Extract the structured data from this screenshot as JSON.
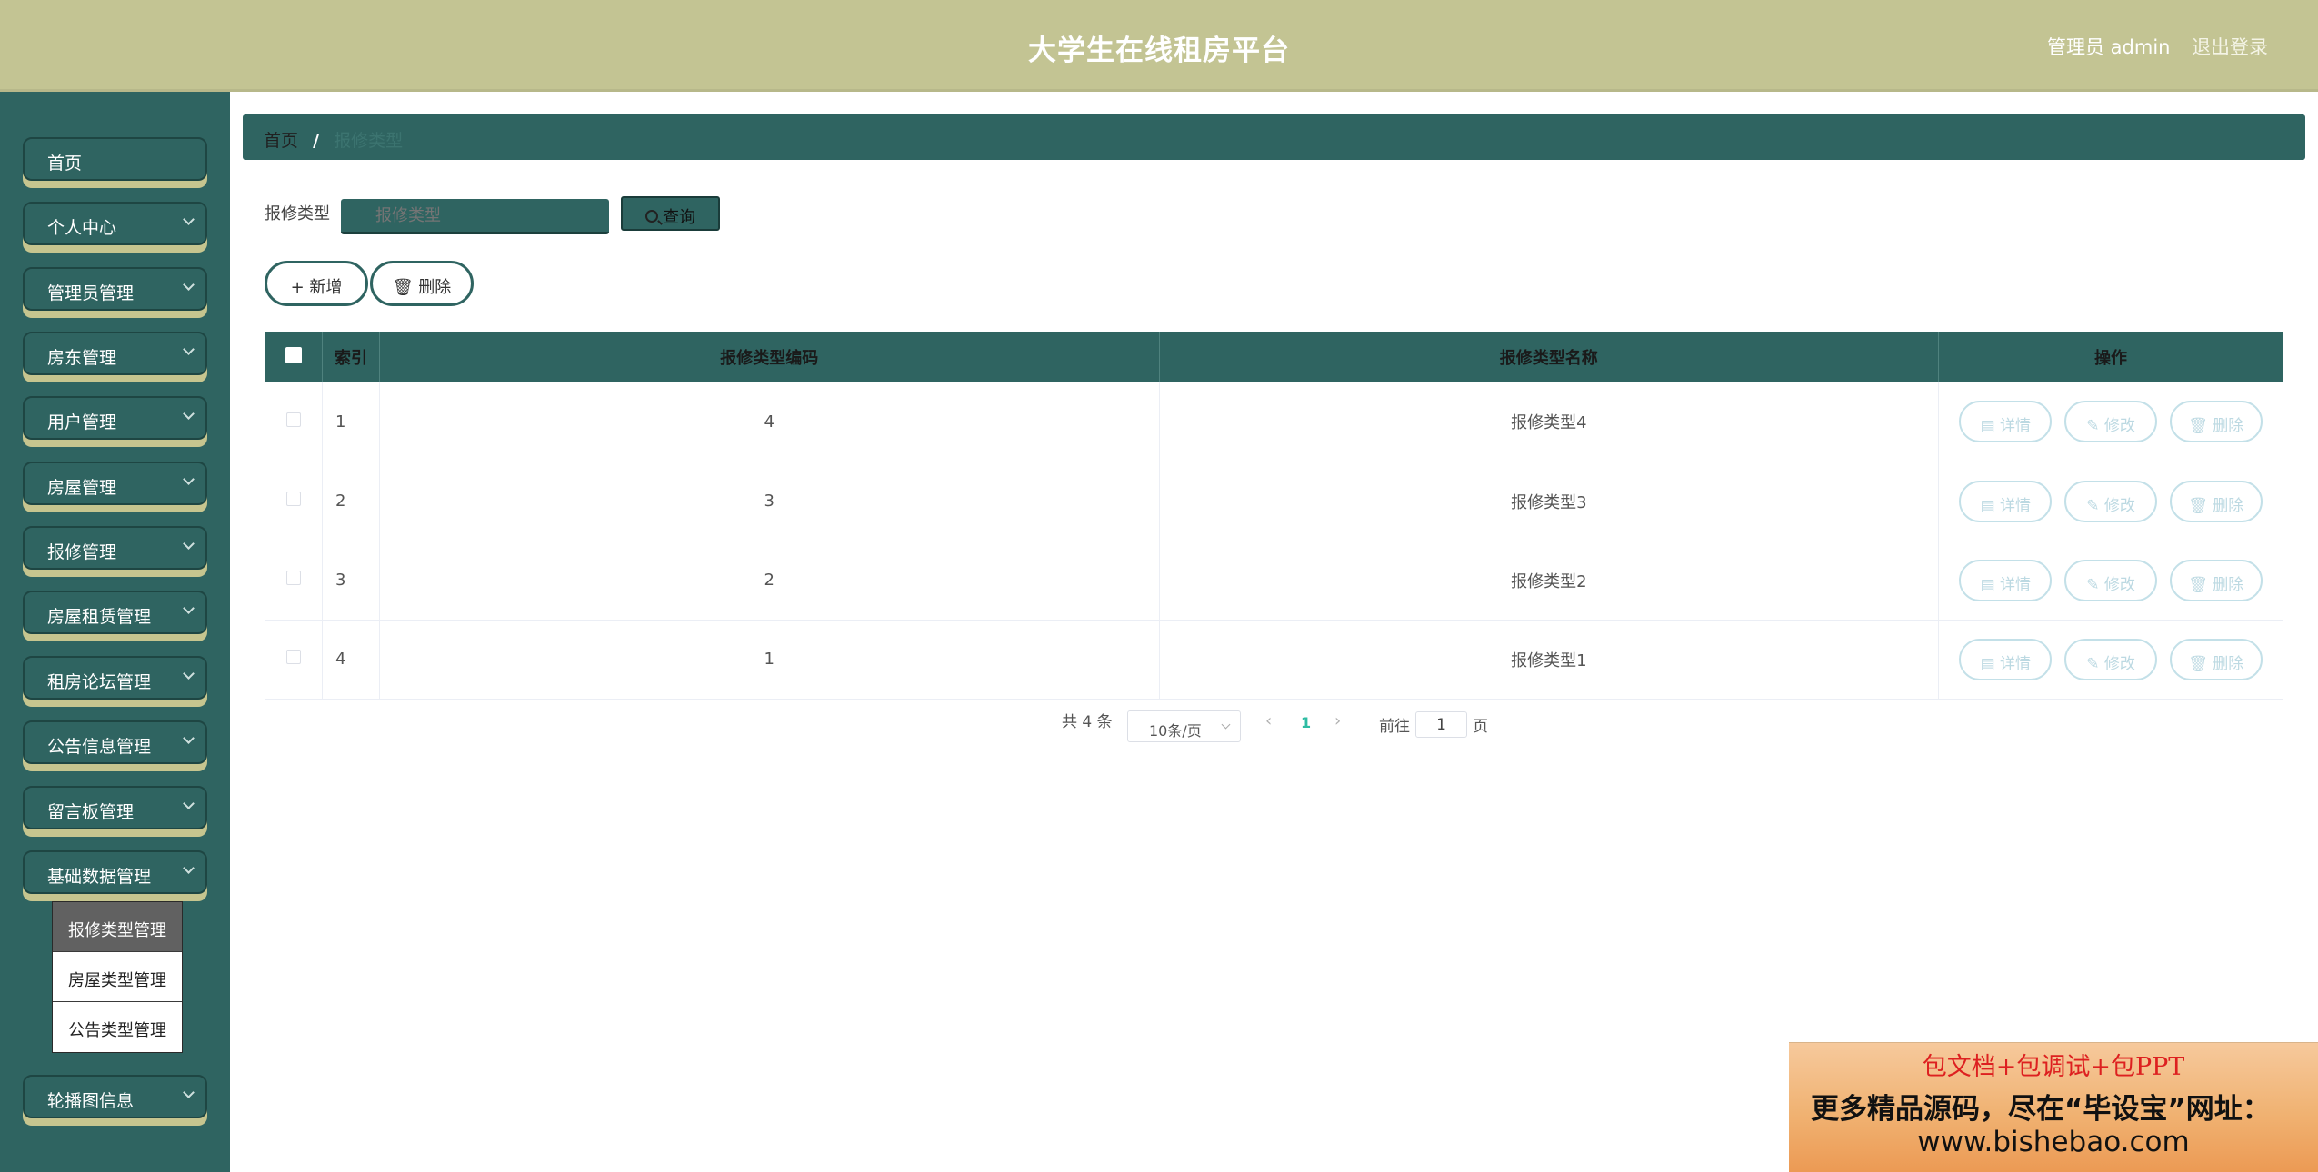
{
  "header": {
    "title": "大学生在线租房平台",
    "admin_label": "管理员 admin",
    "logout_label": "退出登录"
  },
  "sidebar": {
    "items": [
      {
        "label": "首页",
        "has_arrow": false
      },
      {
        "label": "个人中心",
        "has_arrow": true
      },
      {
        "label": "管理员管理",
        "has_arrow": true
      },
      {
        "label": "房东管理",
        "has_arrow": true
      },
      {
        "label": "用户管理",
        "has_arrow": true
      },
      {
        "label": "房屋管理",
        "has_arrow": true
      },
      {
        "label": "报修管理",
        "has_arrow": true
      },
      {
        "label": "房屋租赁管理",
        "has_arrow": true
      },
      {
        "label": "租房论坛管理",
        "has_arrow": true
      },
      {
        "label": "公告信息管理",
        "has_arrow": true
      },
      {
        "label": "留言板管理",
        "has_arrow": true
      },
      {
        "label": "基础数据管理",
        "has_arrow": true
      },
      {
        "label": "轮播图信息",
        "has_arrow": true
      }
    ],
    "submenu": [
      {
        "label": "报修类型管理",
        "active": true
      },
      {
        "label": "房屋类型管理",
        "active": false
      },
      {
        "label": "公告类型管理",
        "active": false
      }
    ]
  },
  "breadcrumb": {
    "home": "首页",
    "separator": "/",
    "current": "报修类型"
  },
  "search": {
    "label": "报修类型",
    "placeholder": "报修类型",
    "button_label": "查询"
  },
  "actions": {
    "add_label": "新增",
    "delete_label": "删除"
  },
  "table": {
    "columns": [
      "索引",
      "报修类型编码",
      "报修类型名称",
      "操作"
    ],
    "rows": [
      {
        "index": "1",
        "code": "4",
        "name": "报修类型4"
      },
      {
        "index": "2",
        "code": "3",
        "name": "报修类型3"
      },
      {
        "index": "3",
        "code": "2",
        "name": "报修类型2"
      },
      {
        "index": "4",
        "code": "1",
        "name": "报修类型1"
      }
    ],
    "row_actions": {
      "detail": "详情",
      "edit": "修改",
      "delete": "删除"
    }
  },
  "pagination": {
    "total": "共 4 条",
    "page_size": "10条/页",
    "current_page": "1",
    "goto_label": "前往",
    "goto_value": "1",
    "page_suffix": "页"
  },
  "ad": {
    "line1": "包文档+包调试+包PPT",
    "line2": "更多精品源码，尽在“毕设宝”网址：",
    "line3": "www.bishebao.com"
  },
  "colors": {
    "header_bg": "#c3c493",
    "sidebar_bg": "#2f6461",
    "accent": "#2ebca3"
  }
}
